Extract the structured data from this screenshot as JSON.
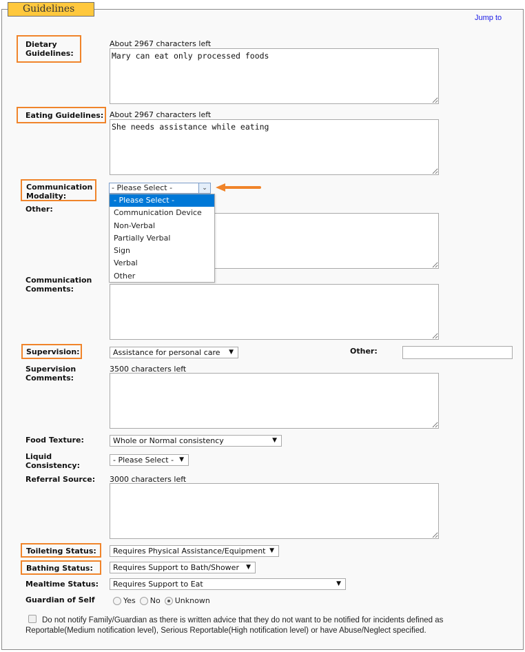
{
  "section": {
    "legend": "Guidelines",
    "jump_link": "Jump to"
  },
  "colors": {
    "legend_bg": "#ffc83d",
    "highlight_border": "#f0842a",
    "selected_option_bg": "#0078d7",
    "link": "#1a1ae6"
  },
  "dietary": {
    "label": "Dietary Guidelines:",
    "count": "About 2967 characters left",
    "value": "Mary can eat only processed foods"
  },
  "eating": {
    "label": "Eating Guidelines:",
    "count": "About 2967 characters left",
    "value": "She needs assistance while eating"
  },
  "communication_modality": {
    "label": "Communication Modality:",
    "selected": "- Please Select -",
    "options": [
      "- Please Select -",
      "Communication Device",
      "Non-Verbal",
      "Partially Verbal",
      "Sign",
      "Verbal",
      "Other"
    ]
  },
  "other": {
    "label": "Other:",
    "value": ""
  },
  "communication_comments": {
    "label": "Communication Comments:",
    "value": ""
  },
  "supervision": {
    "label": "Supervision:",
    "selected": "Assistance for personal care",
    "other_label": "Other:",
    "other_value": ""
  },
  "supervision_comments": {
    "label": "Supervision Comments:",
    "count": "3500 characters left",
    "value": ""
  },
  "food_texture": {
    "label": "Food Texture:",
    "selected": "Whole or Normal consistency"
  },
  "liquid_consistency": {
    "label": "Liquid Consistency:",
    "selected": "- Please Select -"
  },
  "referral_source": {
    "label": "Referral Source:",
    "count": "3000 characters left",
    "value": ""
  },
  "toileting_status": {
    "label": "Toileting Status:",
    "selected": "Requires Physical Assistance/Equipment"
  },
  "bathing_status": {
    "label": "Bathing Status:",
    "selected": "Requires Support to Bath/Shower"
  },
  "mealtime_status": {
    "label": "Mealtime Status:",
    "selected": "Requires Support to Eat"
  },
  "guardian_of_self": {
    "label": "Guardian of Self",
    "options": [
      "Yes",
      "No",
      "Unknown"
    ],
    "selected": "Unknown"
  },
  "notify": {
    "checked": false,
    "text": "Do not notify Family/Guardian as there is written advice that they do not want to be notified for incidents defined as Reportable(Medium notification level), Serious Reportable(High notification level) or have Abuse/Neglect specified."
  }
}
